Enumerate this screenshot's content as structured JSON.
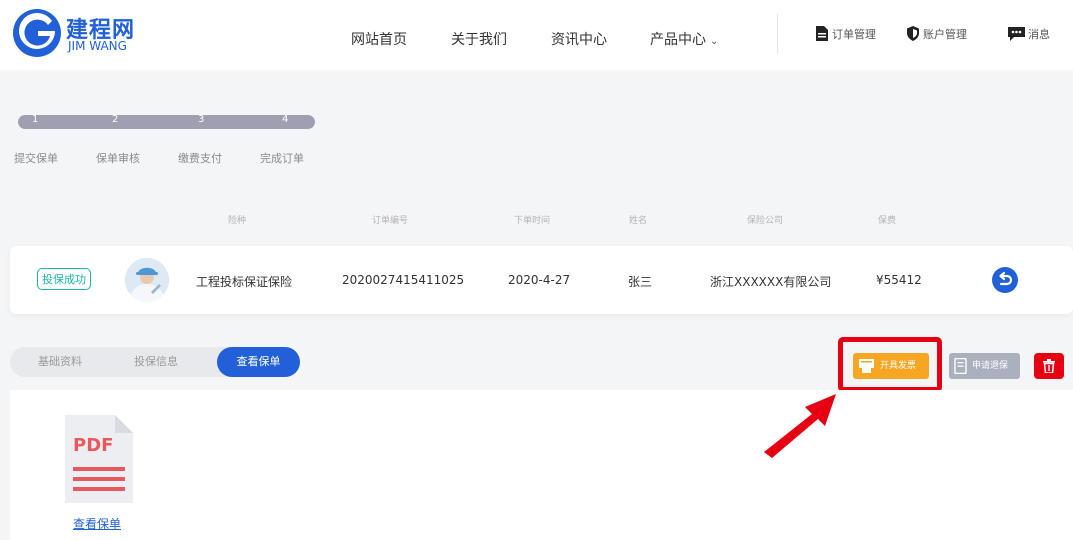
{
  "brand": {
    "name_cn": "建程网",
    "name_en": "JIM WANG",
    "color": "#2160d8"
  },
  "nav": {
    "items": [
      "网站首页",
      "关于我们",
      "资讯中心",
      "产品中心"
    ],
    "dropdown_icon": "chevron-down-icon"
  },
  "utility": {
    "orders": "订单管理",
    "account": "账户管理",
    "messages": "消息"
  },
  "steps": {
    "numbers": [
      "1",
      "2",
      "3",
      "4"
    ],
    "labels": [
      "提交保单",
      "保单审核",
      "缴费支付",
      "完成订单"
    ],
    "current": 4,
    "total": 4
  },
  "columns": [
    "险种",
    "订单编号",
    "下单时间",
    "姓名",
    "保险公司",
    "保费"
  ],
  "order": {
    "status": "投保成功",
    "type": "工程投标保证保险",
    "order_no": "2020027415411025",
    "date": "2020-4-27",
    "name": "张三",
    "company": "浙江XXXXXX有限公司",
    "premium": "¥55412",
    "status_color": "#1bb7a4"
  },
  "tabs": {
    "items": [
      "基础资料",
      "投保信息",
      "查看保单"
    ],
    "active": "查看保单"
  },
  "actions": {
    "invoice": "开具发票",
    "refund": "申请退保",
    "invoice_color": "#f6a623",
    "delete_color": "#e60012"
  },
  "document": {
    "badge": "PDF",
    "link": "查看保单"
  }
}
